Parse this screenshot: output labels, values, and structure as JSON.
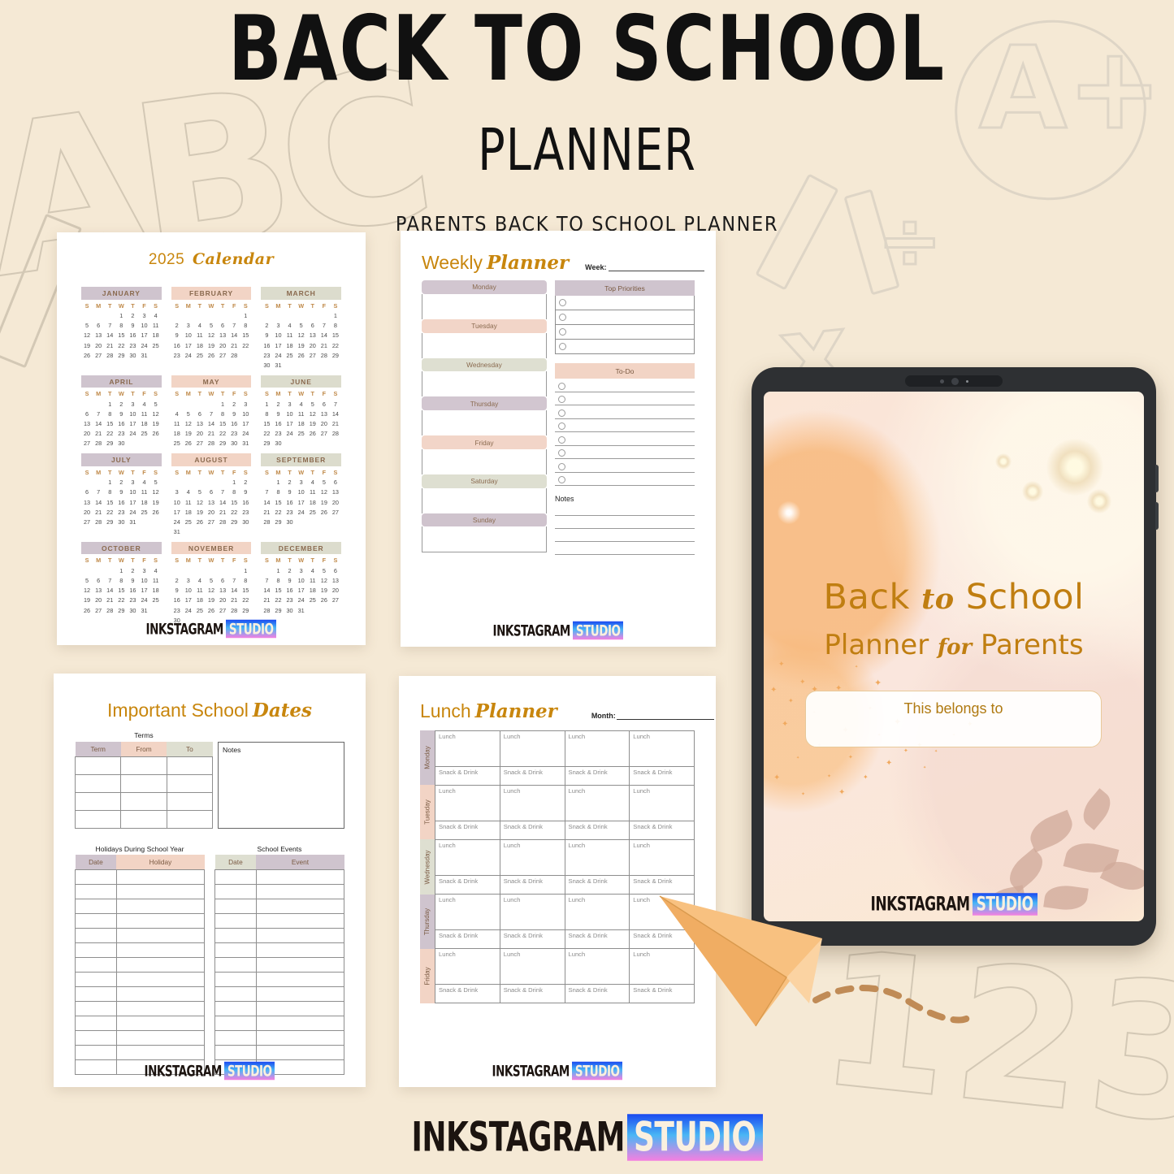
{
  "header": {
    "title": "BACK TO SCHOOL",
    "subtitle": "PLANNER",
    "tagline": "PARENTS BACK TO SCHOOL PLANNER"
  },
  "brand": {
    "part1": "INKSTAGRAM",
    "part2": "STUDIO"
  },
  "colors": {
    "background": "#f5e9d5",
    "gold": "#c8860d",
    "lavender": "#cfc4ce",
    "peach": "#f2d4c5",
    "sage": "#dcdccd",
    "doodle": "#d9cfbd"
  },
  "calendar_page": {
    "title_year": "2025",
    "title_script": "Calendar",
    "weekday_initials": [
      "S",
      "M",
      "T",
      "W",
      "T",
      "F",
      "S"
    ],
    "months": [
      {
        "name": "JANUARY",
        "color": "#cfc4ce",
        "weeks": [
          [
            "",
            "",
            "",
            "1",
            "2",
            "3",
            "4"
          ],
          [
            "5",
            "6",
            "7",
            "8",
            "9",
            "10",
            "11"
          ],
          [
            "12",
            "13",
            "14",
            "15",
            "16",
            "17",
            "18"
          ],
          [
            "19",
            "20",
            "21",
            "22",
            "23",
            "24",
            "25"
          ],
          [
            "26",
            "27",
            "28",
            "29",
            "30",
            "31",
            ""
          ]
        ]
      },
      {
        "name": "FEBRUARY",
        "color": "#f2d4c5",
        "weeks": [
          [
            "",
            "",
            "",
            "",
            "",
            "",
            "1"
          ],
          [
            "2",
            "3",
            "4",
            "5",
            "6",
            "7",
            "8"
          ],
          [
            "9",
            "10",
            "11",
            "12",
            "13",
            "14",
            "15"
          ],
          [
            "16",
            "17",
            "18",
            "19",
            "20",
            "21",
            "22"
          ],
          [
            "23",
            "24",
            "25",
            "26",
            "27",
            "28",
            ""
          ]
        ]
      },
      {
        "name": "MARCH",
        "color": "#dcdccd",
        "weeks": [
          [
            "",
            "",
            "",
            "",
            "",
            "",
            "1"
          ],
          [
            "2",
            "3",
            "4",
            "5",
            "6",
            "7",
            "8"
          ],
          [
            "9",
            "10",
            "11",
            "12",
            "13",
            "14",
            "15"
          ],
          [
            "16",
            "17",
            "18",
            "19",
            "20",
            "21",
            "22"
          ],
          [
            "23",
            "24",
            "25",
            "26",
            "27",
            "28",
            "29"
          ],
          [
            "30",
            "31",
            "",
            "",
            "",
            "",
            ""
          ]
        ]
      },
      {
        "name": "APRIL",
        "color": "#cfc4ce",
        "weeks": [
          [
            "",
            "",
            "1",
            "2",
            "3",
            "4",
            "5"
          ],
          [
            "6",
            "7",
            "8",
            "9",
            "10",
            "11",
            "12"
          ],
          [
            "13",
            "14",
            "15",
            "16",
            "17",
            "18",
            "19"
          ],
          [
            "20",
            "21",
            "22",
            "23",
            "24",
            "25",
            "26"
          ],
          [
            "27",
            "28",
            "29",
            "30",
            "",
            "",
            ""
          ]
        ]
      },
      {
        "name": "MAY",
        "color": "#f2d4c5",
        "weeks": [
          [
            "",
            "",
            "",
            "",
            "1",
            "2",
            "3"
          ],
          [
            "4",
            "5",
            "6",
            "7",
            "8",
            "9",
            "10"
          ],
          [
            "11",
            "12",
            "13",
            "14",
            "15",
            "16",
            "17"
          ],
          [
            "18",
            "19",
            "20",
            "21",
            "22",
            "23",
            "24"
          ],
          [
            "25",
            "26",
            "27",
            "28",
            "29",
            "30",
            "31"
          ]
        ]
      },
      {
        "name": "JUNE",
        "color": "#dcdccd",
        "weeks": [
          [
            "1",
            "2",
            "3",
            "4",
            "5",
            "6",
            "7"
          ],
          [
            "8",
            "9",
            "10",
            "11",
            "12",
            "13",
            "14"
          ],
          [
            "15",
            "16",
            "17",
            "18",
            "19",
            "20",
            "21"
          ],
          [
            "22",
            "23",
            "24",
            "25",
            "26",
            "27",
            "28"
          ],
          [
            "29",
            "30",
            "",
            "",
            "",
            "",
            ""
          ]
        ]
      },
      {
        "name": "JULY",
        "color": "#cfc4ce",
        "weeks": [
          [
            "",
            "",
            "1",
            "2",
            "3",
            "4",
            "5"
          ],
          [
            "6",
            "7",
            "8",
            "9",
            "10",
            "11",
            "12"
          ],
          [
            "13",
            "14",
            "15",
            "16",
            "17",
            "18",
            "19"
          ],
          [
            "20",
            "21",
            "22",
            "23",
            "24",
            "25",
            "26"
          ],
          [
            "27",
            "28",
            "29",
            "30",
            "31",
            "",
            ""
          ]
        ]
      },
      {
        "name": "AUGUST",
        "color": "#f2d4c5",
        "weeks": [
          [
            "",
            "",
            "",
            "",
            "",
            "1",
            "2"
          ],
          [
            "3",
            "4",
            "5",
            "6",
            "7",
            "8",
            "9"
          ],
          [
            "10",
            "11",
            "12",
            "13",
            "14",
            "15",
            "16"
          ],
          [
            "17",
            "18",
            "19",
            "20",
            "21",
            "22",
            "23"
          ],
          [
            "24",
            "25",
            "26",
            "27",
            "28",
            "29",
            "30"
          ],
          [
            "31",
            "",
            "",
            "",
            "",
            "",
            ""
          ]
        ]
      },
      {
        "name": "SEPTEMBER",
        "color": "#dcdccd",
        "weeks": [
          [
            "",
            "1",
            "2",
            "3",
            "4",
            "5",
            "6"
          ],
          [
            "7",
            "8",
            "9",
            "10",
            "11",
            "12",
            "13"
          ],
          [
            "14",
            "15",
            "16",
            "17",
            "18",
            "19",
            "20"
          ],
          [
            "21",
            "22",
            "23",
            "24",
            "25",
            "26",
            "27"
          ],
          [
            "28",
            "29",
            "30",
            "",
            "",
            "",
            ""
          ]
        ]
      },
      {
        "name": "OCTOBER",
        "color": "#cfc4ce",
        "weeks": [
          [
            "",
            "",
            "",
            "1",
            "2",
            "3",
            "4"
          ],
          [
            "5",
            "6",
            "7",
            "8",
            "9",
            "10",
            "11"
          ],
          [
            "12",
            "13",
            "14",
            "15",
            "16",
            "17",
            "18"
          ],
          [
            "19",
            "20",
            "21",
            "22",
            "23",
            "24",
            "25"
          ],
          [
            "26",
            "27",
            "28",
            "29",
            "30",
            "31",
            ""
          ]
        ]
      },
      {
        "name": "NOVEMBER",
        "color": "#f2d4c5",
        "weeks": [
          [
            "",
            "",
            "",
            "",
            "",
            "",
            "1"
          ],
          [
            "2",
            "3",
            "4",
            "5",
            "6",
            "7",
            "8"
          ],
          [
            "9",
            "10",
            "11",
            "12",
            "13",
            "14",
            "15"
          ],
          [
            "16",
            "17",
            "18",
            "19",
            "20",
            "21",
            "22"
          ],
          [
            "23",
            "24",
            "25",
            "26",
            "27",
            "28",
            "29"
          ],
          [
            "30",
            "",
            "",
            "",
            "",
            "",
            ""
          ]
        ]
      },
      {
        "name": "DECEMBER",
        "color": "#dcdccd",
        "weeks": [
          [
            "",
            "1",
            "2",
            "3",
            "4",
            "5",
            "6"
          ],
          [
            "7",
            "8",
            "9",
            "10",
            "11",
            "12",
            "13"
          ],
          [
            "14",
            "15",
            "16",
            "17",
            "18",
            "19",
            "20"
          ],
          [
            "21",
            "22",
            "23",
            "24",
            "25",
            "26",
            "27"
          ],
          [
            "28",
            "29",
            "30",
            "31",
            "",
            "",
            ""
          ]
        ]
      }
    ]
  },
  "weekly_page": {
    "title_main": "Weekly",
    "title_script": "Planner",
    "week_label": "Week:",
    "week_value": "",
    "days": [
      {
        "label": "Monday",
        "color": "#d2c6d0"
      },
      {
        "label": "Tuesday",
        "color": "#f2d5c8"
      },
      {
        "label": "Wednesday",
        "color": "#dedfd1"
      },
      {
        "label": "Thursday",
        "color": "#d2c6d0"
      },
      {
        "label": "Friday",
        "color": "#f2d5c8"
      },
      {
        "label": "Saturday",
        "color": "#dedfd1"
      },
      {
        "label": "Sunday",
        "color": "#cfc3cd"
      }
    ],
    "priorities": {
      "header": "Top Priorities",
      "header_color": "#cfc4ce",
      "rows": 4
    },
    "todo": {
      "header": "To-Do",
      "header_color": "#f2d4c5",
      "rows": 8
    },
    "notes": {
      "label": "Notes",
      "lines": 4
    }
  },
  "dates_page": {
    "title_main": "Important School",
    "title_script": "Dates",
    "terms": {
      "caption": "Terms",
      "columns": [
        {
          "label": "Term",
          "color": "#cfc4ce"
        },
        {
          "label": "From",
          "color": "#f2d4c5"
        },
        {
          "label": "To",
          "color": "#dedfd1"
        }
      ],
      "rows": 4
    },
    "notes_label": "Notes",
    "holidays": {
      "caption": "Holidays During School Year",
      "columns": [
        {
          "label": "Date",
          "color": "#cfc4ce"
        },
        {
          "label": "Holiday",
          "color": "#f2d4c5"
        }
      ],
      "rows": 14
    },
    "events": {
      "caption": "School Events",
      "columns": [
        {
          "label": "Date",
          "color": "#dedfd1"
        },
        {
          "label": "Event",
          "color": "#cfc4ce"
        }
      ],
      "rows": 14
    }
  },
  "lunch_page": {
    "title_main": "Lunch",
    "title_script": "Planner",
    "month_label": "Month:",
    "month_value": "",
    "columns": 4,
    "lunch_label": "Lunch",
    "snack_label": "Snack & Drink",
    "days": [
      {
        "label": "Monday",
        "color": "#cfc4ce"
      },
      {
        "label": "Tuesday",
        "color": "#f2d4c5"
      },
      {
        "label": "Wednesday",
        "color": "#dedfd1"
      },
      {
        "label": "Thursday",
        "color": "#cfc4ce"
      },
      {
        "label": "Friday",
        "color": "#f2d4c5"
      }
    ]
  },
  "tablet": {
    "cover_title_a": "Back",
    "cover_title_script": "to",
    "cover_title_b": "School",
    "cover_sub_a": "Planner",
    "cover_sub_script": "for",
    "cover_sub_b": "Parents",
    "belongs_to": "This belongs to"
  },
  "doodles": {
    "abc": "ABC",
    "aplus": "A+",
    "numbers": "123",
    "multiply": "x",
    "divide": "÷"
  }
}
